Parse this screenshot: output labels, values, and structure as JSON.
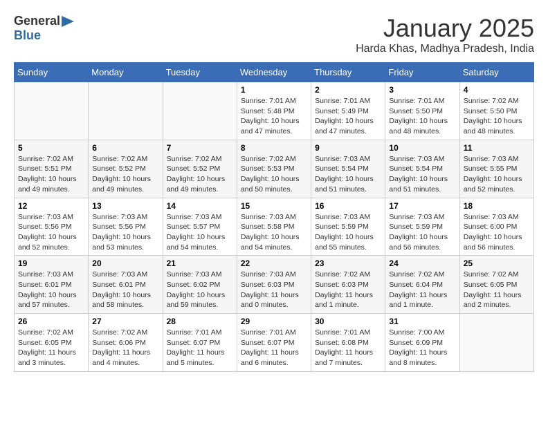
{
  "logo": {
    "general": "General",
    "blue": "Blue"
  },
  "title": {
    "month": "January 2025",
    "location": "Harda Khas, Madhya Pradesh, India"
  },
  "headers": [
    "Sunday",
    "Monday",
    "Tuesday",
    "Wednesday",
    "Thursday",
    "Friday",
    "Saturday"
  ],
  "weeks": [
    [
      {
        "day": "",
        "info": ""
      },
      {
        "day": "",
        "info": ""
      },
      {
        "day": "",
        "info": ""
      },
      {
        "day": "1",
        "info": "Sunrise: 7:01 AM\nSunset: 5:48 PM\nDaylight: 10 hours\nand 47 minutes."
      },
      {
        "day": "2",
        "info": "Sunrise: 7:01 AM\nSunset: 5:49 PM\nDaylight: 10 hours\nand 47 minutes."
      },
      {
        "day": "3",
        "info": "Sunrise: 7:01 AM\nSunset: 5:50 PM\nDaylight: 10 hours\nand 48 minutes."
      },
      {
        "day": "4",
        "info": "Sunrise: 7:02 AM\nSunset: 5:50 PM\nDaylight: 10 hours\nand 48 minutes."
      }
    ],
    [
      {
        "day": "5",
        "info": "Sunrise: 7:02 AM\nSunset: 5:51 PM\nDaylight: 10 hours\nand 49 minutes."
      },
      {
        "day": "6",
        "info": "Sunrise: 7:02 AM\nSunset: 5:52 PM\nDaylight: 10 hours\nand 49 minutes."
      },
      {
        "day": "7",
        "info": "Sunrise: 7:02 AM\nSunset: 5:52 PM\nDaylight: 10 hours\nand 49 minutes."
      },
      {
        "day": "8",
        "info": "Sunrise: 7:02 AM\nSunset: 5:53 PM\nDaylight: 10 hours\nand 50 minutes."
      },
      {
        "day": "9",
        "info": "Sunrise: 7:03 AM\nSunset: 5:54 PM\nDaylight: 10 hours\nand 51 minutes."
      },
      {
        "day": "10",
        "info": "Sunrise: 7:03 AM\nSunset: 5:54 PM\nDaylight: 10 hours\nand 51 minutes."
      },
      {
        "day": "11",
        "info": "Sunrise: 7:03 AM\nSunset: 5:55 PM\nDaylight: 10 hours\nand 52 minutes."
      }
    ],
    [
      {
        "day": "12",
        "info": "Sunrise: 7:03 AM\nSunset: 5:56 PM\nDaylight: 10 hours\nand 52 minutes."
      },
      {
        "day": "13",
        "info": "Sunrise: 7:03 AM\nSunset: 5:56 PM\nDaylight: 10 hours\nand 53 minutes."
      },
      {
        "day": "14",
        "info": "Sunrise: 7:03 AM\nSunset: 5:57 PM\nDaylight: 10 hours\nand 54 minutes."
      },
      {
        "day": "15",
        "info": "Sunrise: 7:03 AM\nSunset: 5:58 PM\nDaylight: 10 hours\nand 54 minutes."
      },
      {
        "day": "16",
        "info": "Sunrise: 7:03 AM\nSunset: 5:59 PM\nDaylight: 10 hours\nand 55 minutes."
      },
      {
        "day": "17",
        "info": "Sunrise: 7:03 AM\nSunset: 5:59 PM\nDaylight: 10 hours\nand 56 minutes."
      },
      {
        "day": "18",
        "info": "Sunrise: 7:03 AM\nSunset: 6:00 PM\nDaylight: 10 hours\nand 56 minutes."
      }
    ],
    [
      {
        "day": "19",
        "info": "Sunrise: 7:03 AM\nSunset: 6:01 PM\nDaylight: 10 hours\nand 57 minutes."
      },
      {
        "day": "20",
        "info": "Sunrise: 7:03 AM\nSunset: 6:01 PM\nDaylight: 10 hours\nand 58 minutes."
      },
      {
        "day": "21",
        "info": "Sunrise: 7:03 AM\nSunset: 6:02 PM\nDaylight: 10 hours\nand 59 minutes."
      },
      {
        "day": "22",
        "info": "Sunrise: 7:03 AM\nSunset: 6:03 PM\nDaylight: 11 hours\nand 0 minutes."
      },
      {
        "day": "23",
        "info": "Sunrise: 7:02 AM\nSunset: 6:03 PM\nDaylight: 11 hours\nand 1 minute."
      },
      {
        "day": "24",
        "info": "Sunrise: 7:02 AM\nSunset: 6:04 PM\nDaylight: 11 hours\nand 1 minute."
      },
      {
        "day": "25",
        "info": "Sunrise: 7:02 AM\nSunset: 6:05 PM\nDaylight: 11 hours\nand 2 minutes."
      }
    ],
    [
      {
        "day": "26",
        "info": "Sunrise: 7:02 AM\nSunset: 6:05 PM\nDaylight: 11 hours\nand 3 minutes."
      },
      {
        "day": "27",
        "info": "Sunrise: 7:02 AM\nSunset: 6:06 PM\nDaylight: 11 hours\nand 4 minutes."
      },
      {
        "day": "28",
        "info": "Sunrise: 7:01 AM\nSunset: 6:07 PM\nDaylight: 11 hours\nand 5 minutes."
      },
      {
        "day": "29",
        "info": "Sunrise: 7:01 AM\nSunset: 6:07 PM\nDaylight: 11 hours\nand 6 minutes."
      },
      {
        "day": "30",
        "info": "Sunrise: 7:01 AM\nSunset: 6:08 PM\nDaylight: 11 hours\nand 7 minutes."
      },
      {
        "day": "31",
        "info": "Sunrise: 7:00 AM\nSunset: 6:09 PM\nDaylight: 11 hours\nand 8 minutes."
      },
      {
        "day": "",
        "info": ""
      }
    ]
  ]
}
